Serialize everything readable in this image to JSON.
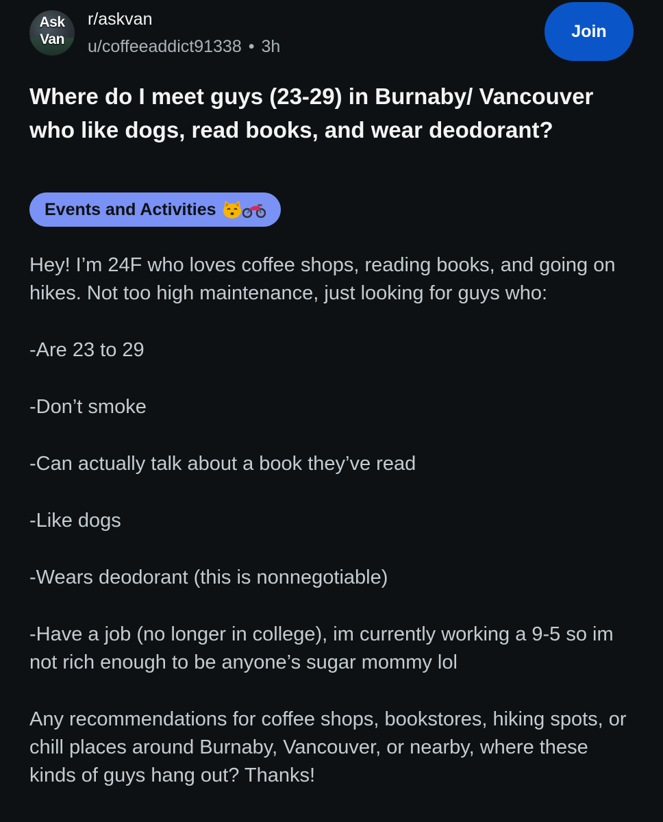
{
  "header": {
    "avatar_line1": "Ask",
    "avatar_line2": "Van",
    "subreddit": "r/askvan",
    "author": "u/coffeeaddict91338",
    "separator": "•",
    "age": "3h",
    "join_label": "Join"
  },
  "post": {
    "title": "Where do I meet guys (23-29) in Burnaby/ Vancouver who like dogs, read books, and wear deodorant?",
    "flair_label": "Events and Activities",
    "flair_icons": [
      "cat-face-icon",
      "motorcycle-icon"
    ],
    "body": [
      "Hey! I’m 24F who loves coffee shops, reading books, and going on hikes. Not too high maintenance, just looking for guys who:",
      "-Are 23 to 29",
      "-Don’t smoke",
      "-Can actually talk about a book they’ve read",
      "-Like dogs",
      "-Wears deodorant (this is nonnegotiable)",
      "-Have a job (no longer in college), im currently working a 9-5 so im not rich enough to be anyone’s sugar mommy lol",
      "Any recommendations for coffee shops, bookstores, hiking spots, or chill places around Burnaby, Vancouver, or nearby, where these kinds of guys hang out? Thanks!"
    ]
  },
  "colors": {
    "background": "#0e1113",
    "join_button": "#0a55c8",
    "flair_background": "#7a92f5",
    "body_text": "#c4ccd1",
    "meta_text": "#aab3b8"
  }
}
